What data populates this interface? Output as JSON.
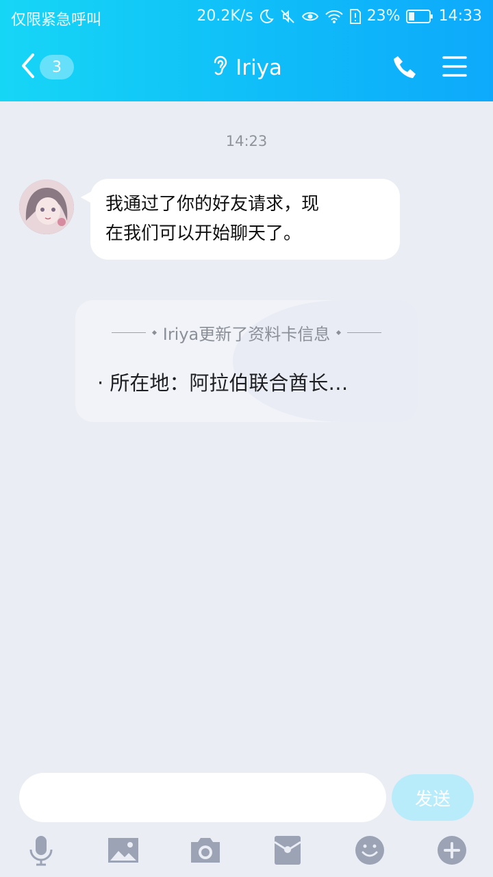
{
  "status_bar": {
    "carrier": "仅限紧急呼叫",
    "speed": "20.2K/s",
    "battery": "23%",
    "time": "14:33"
  },
  "header": {
    "back_count": "3",
    "title": "Iriya"
  },
  "chat": {
    "timestamp": "14:23",
    "message_line1": "我通过了你的好友请求，现",
    "message_line2": "在我们可以开始聊天了。",
    "card_title": "Iriya更新了资料卡信息",
    "card_body": "· 所在地：阿拉伯联合酋长…"
  },
  "input_bar": {
    "send_label": "发送"
  },
  "colors": {
    "header_start": "#16d6f6",
    "header_end": "#0ea9fb",
    "background": "#eaedf4",
    "icon_gray": "#9ba3b5"
  },
  "toolbar": [
    "mic-icon",
    "image-icon",
    "camera-icon",
    "red-packet-icon",
    "emoji-icon",
    "plus-icon"
  ]
}
